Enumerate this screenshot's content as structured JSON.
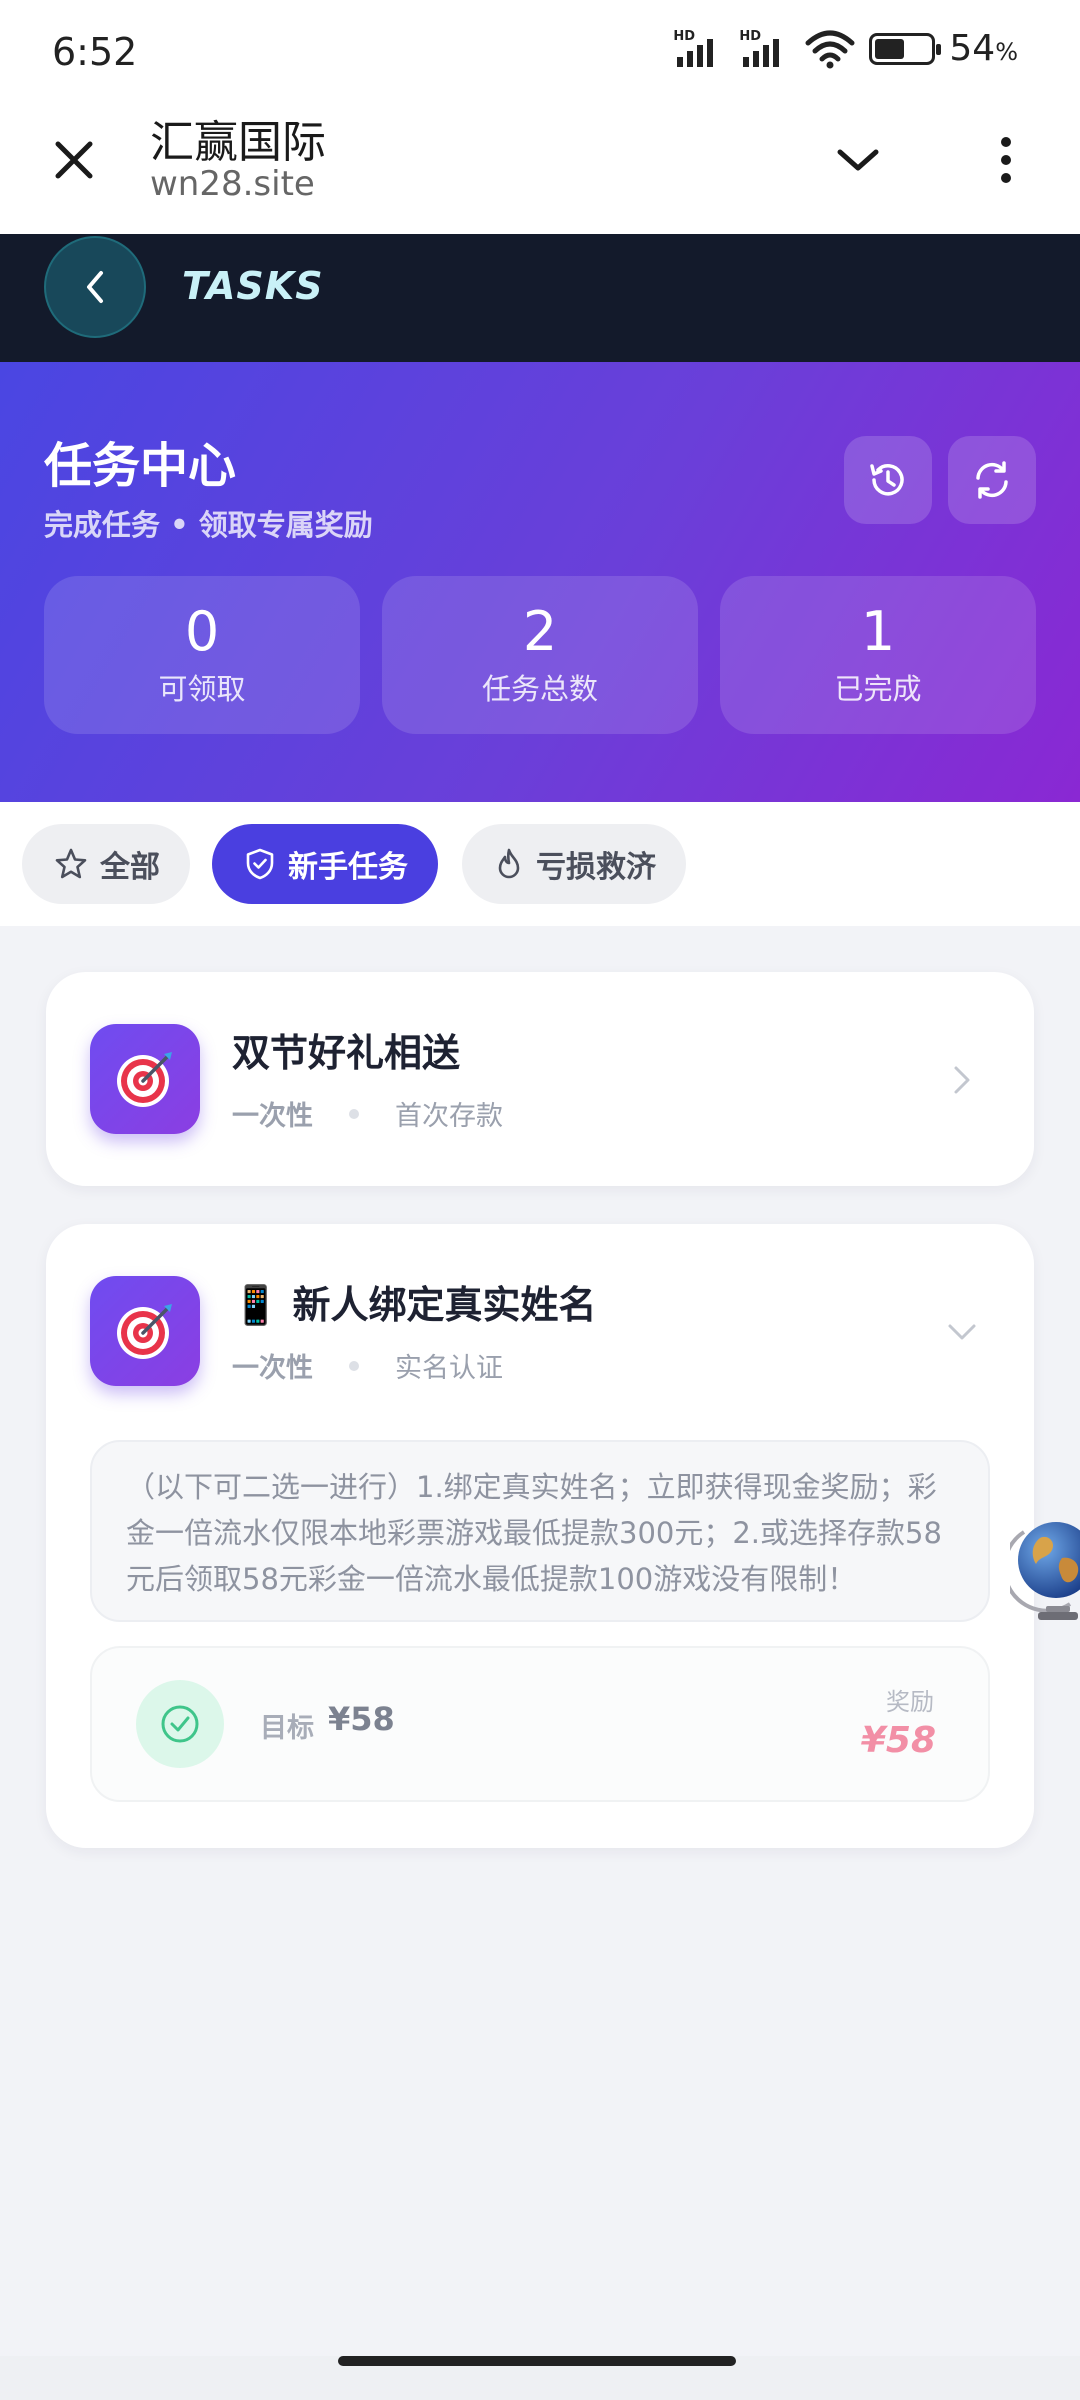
{
  "status_bar": {
    "time": "6:52",
    "hd1": "HD",
    "hd2": "HD",
    "battery_level": 0.54,
    "battery_pct": "54",
    "pct_sign": "%"
  },
  "browser": {
    "title": "汇赢国际",
    "url": "wn28.site"
  },
  "nav": {
    "title": "TASKS"
  },
  "hero": {
    "title": "任务中心",
    "subtitle": "完成任务 • 领取专属奖励",
    "stats": [
      {
        "value": "0",
        "label": "可领取"
      },
      {
        "value": "2",
        "label": "任务总数"
      },
      {
        "value": "1",
        "label": "已完成"
      }
    ]
  },
  "tabs": [
    {
      "label": "全部",
      "icon": "star-icon"
    },
    {
      "label": "新手任务",
      "icon": "shield-icon",
      "active": true
    },
    {
      "label": "亏损救济",
      "icon": "flame-icon"
    }
  ],
  "tasks": [
    {
      "title": "双节好礼相送",
      "type": "一次性",
      "category": "首次存款"
    },
    {
      "title": "📱 新人绑定真实姓名",
      "type": "一次性",
      "category": "实名认证",
      "description": "（以下可二选一进行）1.绑定真实姓名；立即获得现金奖励；彩金一倍流水仅限本地彩票游戏最低提款300元；2.或选择存款58元后领取58元彩金一倍流水最低提款100游戏没有限制！",
      "target_label": "目标",
      "target_value": "¥58",
      "reward_label": "奖励",
      "reward_value": "¥58"
    }
  ],
  "colors": {
    "accent": "#4a3fe0",
    "nav_bg": "#131a2b",
    "reward": "#f28fa6",
    "success": "#3fc58a"
  }
}
